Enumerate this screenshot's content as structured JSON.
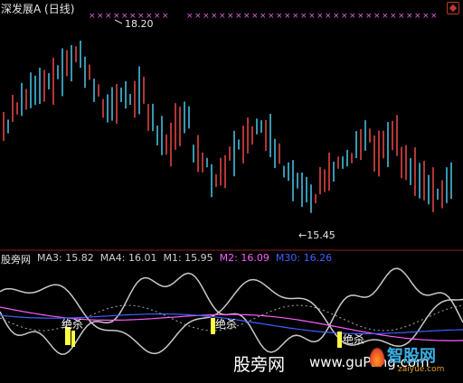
{
  "header": {
    "title": "深发展A (日线)"
  },
  "price_panel": {
    "high_label": "18.20",
    "low_label": "←15.45",
    "high_price": 18.2,
    "low_price": 15.45,
    "colors": {
      "up": "#ff4d4d",
      "down": "#4fd8ff",
      "marker": "#e060e0"
    }
  },
  "indicator_panel": {
    "name": "股旁网",
    "ma3": {
      "label": "MA3:",
      "value": "15.82",
      "color": "#cfcfcf"
    },
    "ma4": {
      "label": "MA4:",
      "value": "16.01",
      "color": "#cfcfcf"
    },
    "m1": {
      "label": "M1:",
      "value": "15.95",
      "color": "#cfcfcf"
    },
    "m2": {
      "label": "M2:",
      "value": "16.09",
      "color": "#ff5cff"
    },
    "m30": {
      "label": "M30:",
      "value": "16.26",
      "color": "#4060ff"
    },
    "signal_label": "绝杀",
    "signal_color": "#ffff40"
  },
  "watermark": {
    "site": "股旁网",
    "url": "www.guPang.com",
    "logo_text": "智股网",
    "logo_url": "zaiyue.com"
  }
}
